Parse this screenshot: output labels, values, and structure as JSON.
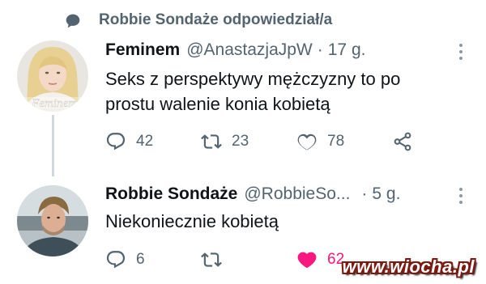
{
  "reply_context": {
    "text": "Robbie Sondaże odpowiedział/a",
    "icon": "speech-bubble-icon"
  },
  "tweets": [
    {
      "name": "Feminem",
      "handle": "@AnastazjaJpW",
      "separator": "·",
      "time": "17 g.",
      "avatar_caption": "Feminem",
      "text": "Seks z perspektywy mężczyzny to po prostu walenie konia kobietą",
      "replies": "42",
      "retweets": "23",
      "likes": "78",
      "liked": false
    },
    {
      "name": "Robbie Sondaże",
      "handle": "@RobbieSo...",
      "separator": "·",
      "time": "5 g.",
      "text": "Niekoniecznie kobietą",
      "replies": "6",
      "retweets": "",
      "likes": "62",
      "liked": true
    }
  ],
  "colors": {
    "secondary_text": "#536471",
    "primary_text": "#0f1419",
    "like_active": "#f91880",
    "thread_line": "#cfd9de"
  },
  "watermark": "www.wiocha.pl"
}
